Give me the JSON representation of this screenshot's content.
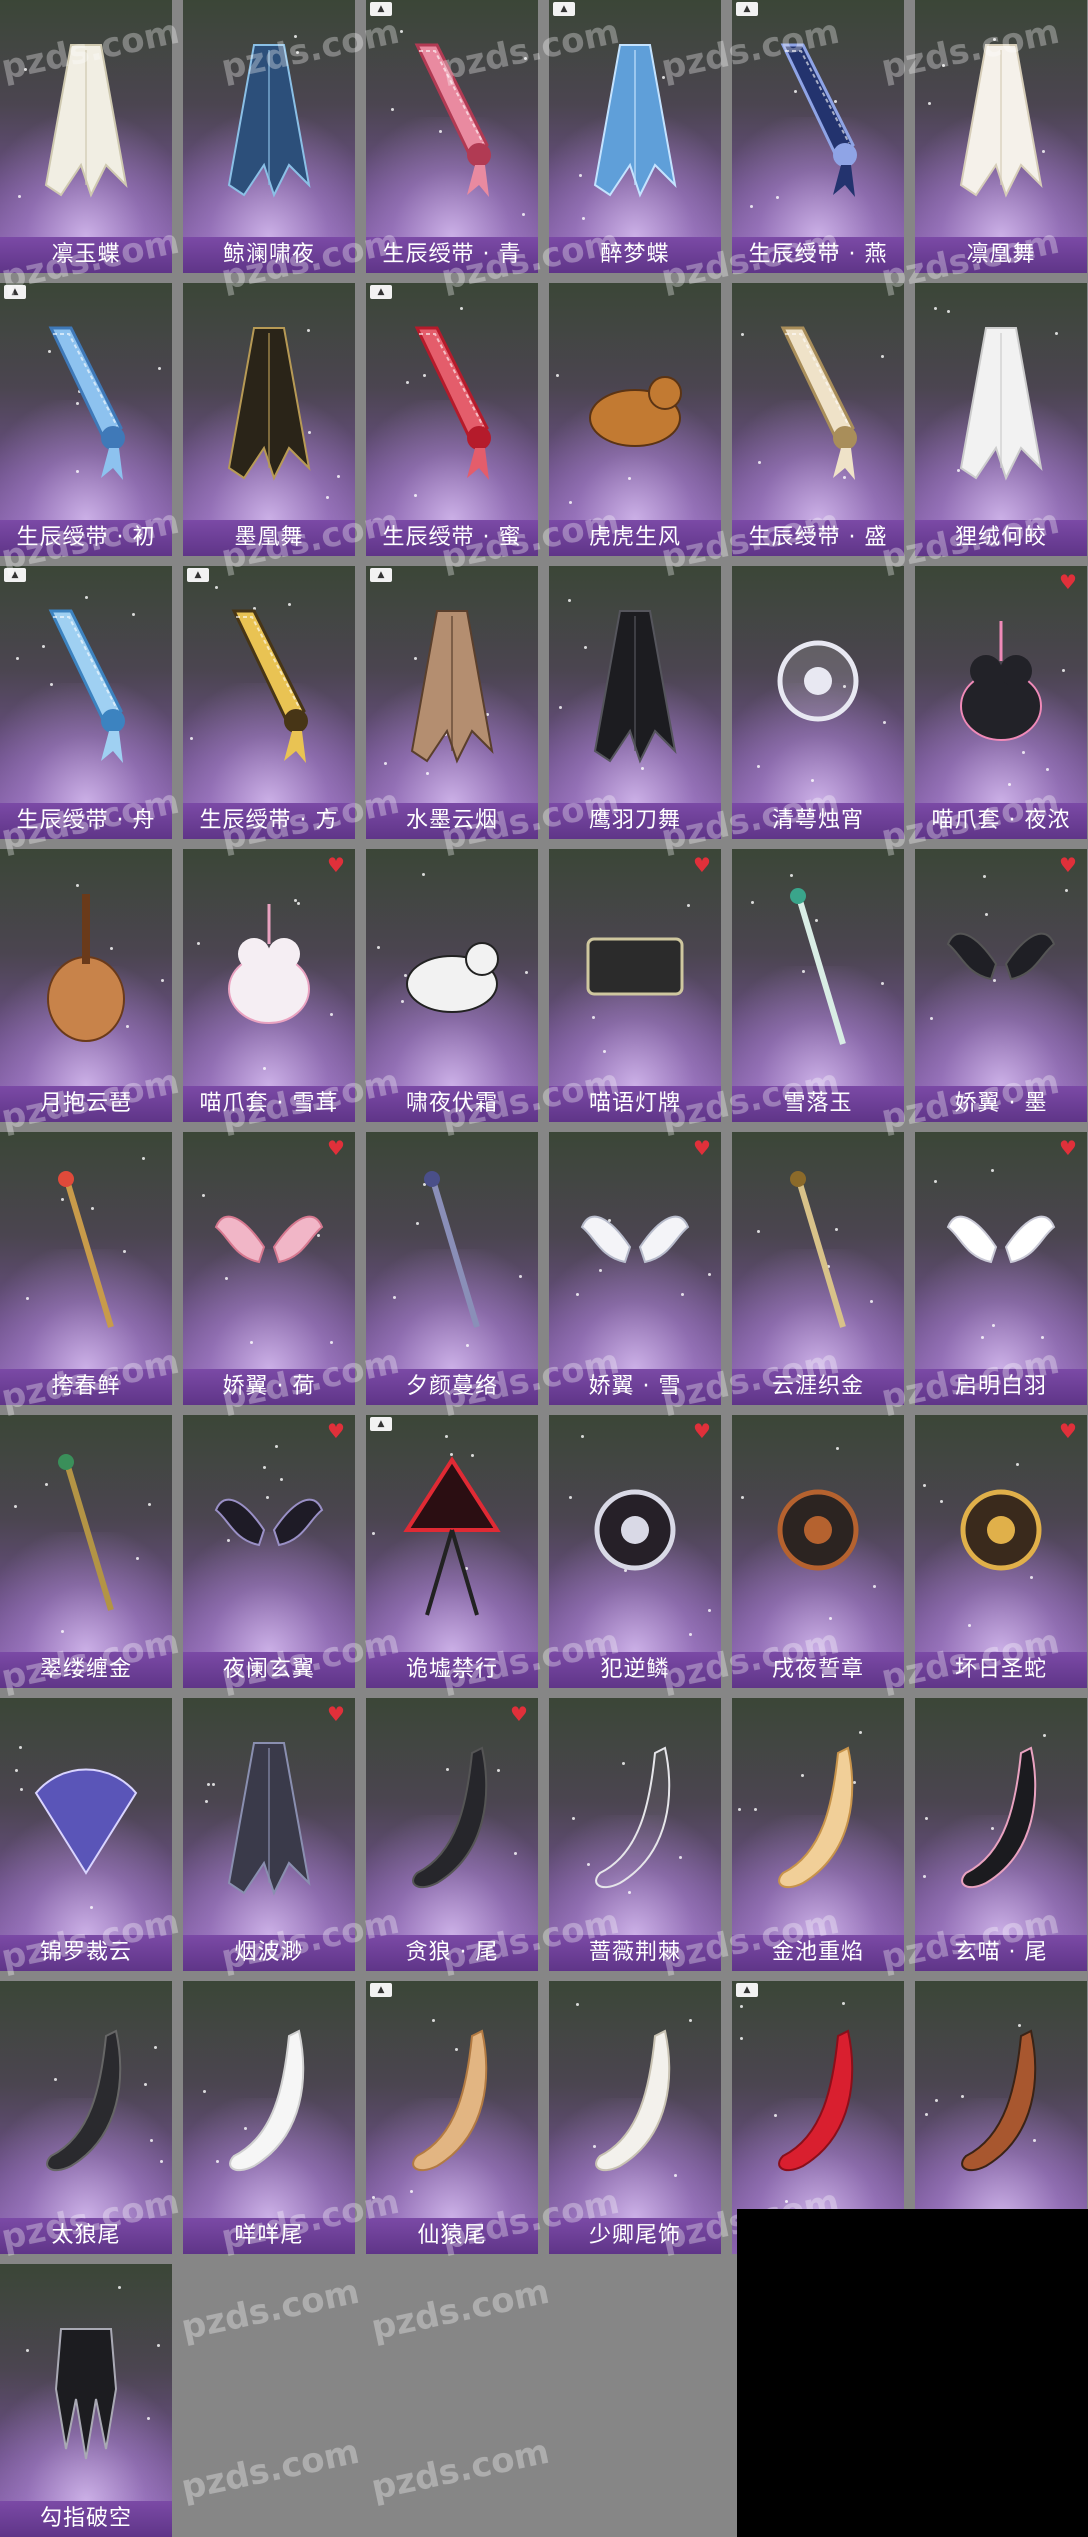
{
  "watermark": "pzds.com",
  "colors": {
    "background": "#868686",
    "label_bar": "#6a3d94",
    "favorite": "#e0303a",
    "black_block": "#000000"
  },
  "items": [
    {
      "label": "凛玉蝶",
      "icon": "white-wing-ornament-icon",
      "new": false,
      "favorite": false
    },
    {
      "label": "鲸澜啸夜",
      "icon": "blue-dark-cape-icon",
      "new": false,
      "favorite": false
    },
    {
      "label": "生辰绶带 · 青",
      "icon": "pink-sash-icon",
      "new": true,
      "favorite": false
    },
    {
      "label": "醉梦蝶",
      "icon": "blue-wing-ornament-icon",
      "new": true,
      "favorite": false
    },
    {
      "label": "生辰绶带 · 燕",
      "icon": "navy-sash-icon",
      "new": true,
      "favorite": false
    },
    {
      "label": "凛凰舞",
      "icon": "white-feather-cape-icon",
      "new": false,
      "favorite": false
    },
    {
      "label": "生辰绶带 · 初",
      "icon": "light-blue-sash-icon",
      "new": true,
      "favorite": false
    },
    {
      "label": "墨凰舞",
      "icon": "black-gold-cape-icon",
      "new": false,
      "favorite": false
    },
    {
      "label": "生辰绶带 · 蜜",
      "icon": "red-sash-icon",
      "new": true,
      "favorite": false
    },
    {
      "label": "虎虎生风",
      "icon": "tiger-costume-icon",
      "new": false,
      "favorite": false
    },
    {
      "label": "生辰绶带 · 盛",
      "icon": "cream-sash-icon",
      "new": false,
      "favorite": false
    },
    {
      "label": "狸绒何皎",
      "icon": "white-fur-cape-icon",
      "new": false,
      "favorite": false
    },
    {
      "label": "生辰绶带 · 舟",
      "icon": "blue-sash-icon",
      "new": true,
      "favorite": false
    },
    {
      "label": "生辰绶带 · 方",
      "icon": "gold-sash-icon",
      "new": true,
      "favorite": false
    },
    {
      "label": "水墨云烟",
      "icon": "ink-robe-icon",
      "new": true,
      "favorite": false
    },
    {
      "label": "鹰羽刀舞",
      "icon": "black-feather-cape-icon",
      "new": false,
      "favorite": false
    },
    {
      "label": "清萼烛宵",
      "icon": "silver-ring-lotus-icon",
      "new": false,
      "favorite": false
    },
    {
      "label": "喵爪套 · 夜浓",
      "icon": "black-cat-paw-icon",
      "new": false,
      "favorite": true
    },
    {
      "label": "月抱云琶",
      "icon": "pipa-lute-icon",
      "new": false,
      "favorite": false
    },
    {
      "label": "喵爪套 · 雪茸",
      "icon": "white-cat-paw-icon",
      "new": false,
      "favorite": true
    },
    {
      "label": "啸夜伏霜",
      "icon": "white-fox-icon",
      "new": false,
      "favorite": false
    },
    {
      "label": "喵语灯牌",
      "icon": "cat-sign-board-icon",
      "new": false,
      "favorite": true
    },
    {
      "label": "雪落玉",
      "icon": "jade-flute-icon",
      "new": false,
      "favorite": false
    },
    {
      "label": "娇翼 · 墨",
      "icon": "black-wings-icon",
      "new": false,
      "favorite": true
    },
    {
      "label": "挎春鲜",
      "icon": "mushroom-pendant-icon",
      "new": false,
      "favorite": false
    },
    {
      "label": "娇翼 · 荷",
      "icon": "pink-wings-icon",
      "new": false,
      "favorite": true
    },
    {
      "label": "夕颜蔓络",
      "icon": "flower-vine-icon",
      "new": false,
      "favorite": false
    },
    {
      "label": "娇翼 · 雪",
      "icon": "white-wings-icon",
      "new": false,
      "favorite": true
    },
    {
      "label": "云涯织金",
      "icon": "gold-tassel-icon",
      "new": false,
      "favorite": false
    },
    {
      "label": "启明白羽",
      "icon": "white-angel-wings-icon",
      "new": false,
      "favorite": true
    },
    {
      "label": "翠缕缠金",
      "icon": "green-gold-staff-icon",
      "new": false,
      "favorite": false
    },
    {
      "label": "夜阑玄翼",
      "icon": "dark-bat-wings-icon",
      "new": false,
      "favorite": true
    },
    {
      "label": "诡墟禁行",
      "icon": "warning-sign-icon",
      "new": true,
      "favorite": false
    },
    {
      "label": "犯逆鳞",
      "icon": "dark-orb-icon",
      "new": false,
      "favorite": true
    },
    {
      "label": "戌夜誓章",
      "icon": "crossed-emblem-icon",
      "new": false,
      "favorite": false
    },
    {
      "label": "坏日圣蛇",
      "icon": "golden-serpent-icon",
      "new": false,
      "favorite": true
    },
    {
      "label": "锦罗裁云",
      "icon": "purple-fan-icon",
      "new": false,
      "favorite": false
    },
    {
      "label": "烟波渺",
      "icon": "mist-cape-icon",
      "new": false,
      "favorite": true
    },
    {
      "label": "贪狼 · 尾",
      "icon": "black-wolf-tail-icon",
      "new": false,
      "favorite": true
    },
    {
      "label": "蔷薇荆棘",
      "icon": "thorn-vine-tail-icon",
      "new": false,
      "favorite": false
    },
    {
      "label": "金池重焰",
      "icon": "golden-fox-tail-icon",
      "new": false,
      "favorite": false
    },
    {
      "label": "玄喵 · 尾",
      "icon": "black-cat-tail-icon",
      "new": false,
      "favorite": false
    },
    {
      "label": "太狼尾",
      "icon": "dark-wolf-tail-icon",
      "new": false,
      "favorite": false
    },
    {
      "label": "咩咩尾",
      "icon": "white-fluffy-tail-icon",
      "new": false,
      "favorite": false
    },
    {
      "label": "仙猿尾",
      "icon": "thin-monkey-tail-icon",
      "new": true,
      "favorite": false
    },
    {
      "label": "少卿尾饰",
      "icon": "white-long-tail-icon",
      "new": false,
      "favorite": false
    },
    {
      "label": "",
      "icon": "red-fox-tail-icon",
      "new": true,
      "favorite": false
    },
    {
      "label": "",
      "icon": "raccoon-tail-icon",
      "new": false,
      "favorite": false
    },
    {
      "label": "勾指破空",
      "icon": "black-claw-icon",
      "new": false,
      "favorite": false
    }
  ]
}
